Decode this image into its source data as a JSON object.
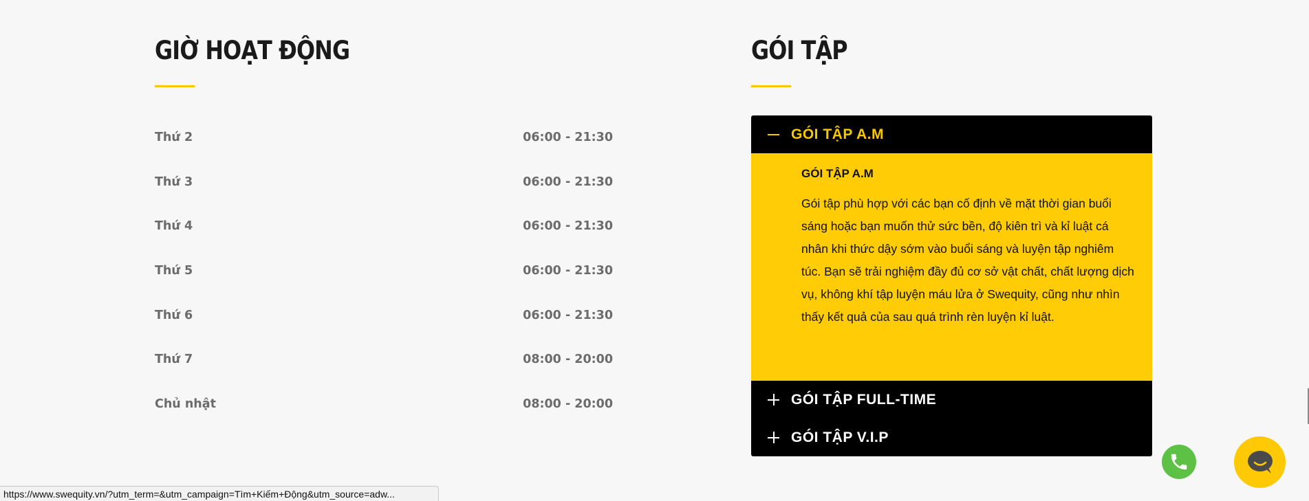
{
  "hours": {
    "title": "GIỜ HOẠT ĐỘNG",
    "rows": [
      {
        "day": "Thứ 2",
        "time": "06:00 - 21:30"
      },
      {
        "day": "Thứ 3",
        "time": "06:00 - 21:30"
      },
      {
        "day": "Thứ 4",
        "time": "06:00 - 21:30"
      },
      {
        "day": "Thứ 5",
        "time": "06:00 - 21:30"
      },
      {
        "day": "Thứ 6",
        "time": "06:00 - 21:30"
      },
      {
        "day": "Thứ 7",
        "time": "08:00 - 20:00"
      },
      {
        "day": "Chủ nhật",
        "time": "08:00 - 20:00"
      }
    ]
  },
  "packages": {
    "title": "GÓI TẬP",
    "items": [
      {
        "label": "GÓI TẬP A.M",
        "expanded": true,
        "panel_title": "GÓI TẬP A.M",
        "panel_text": "Gói tập phù hợp với các bạn cố định về mặt thời gian buổi sáng hoặc bạn muốn thử sức bền, độ kiên trì và kỉ luật cá nhân khi thức dậy sớm vào buổi sáng và luyện tập nghiêm túc. Bạn sẽ trải nghiệm đầy đủ cơ sở vật chất, chất lượng dịch vụ, không khí tập luyện máu lửa ở Swequity, cũng như nhìn thấy kết quả của sau quá trình rèn luyện kỉ luật."
      },
      {
        "label": "GÓI TẬP FULL-TIME",
        "expanded": false
      },
      {
        "label": "GÓI TẬP V.I.P",
        "expanded": false
      }
    ]
  },
  "floating": {
    "phone_icon": "phone-icon",
    "chat_icon": "chat-bubble-icon"
  },
  "status_bar": {
    "url": "https://www.swequity.vn/?utm_term=&utm_campaign=Tìm+Kiếm+Động&utm_source=adw..."
  },
  "colors": {
    "accent": "#ffcc06",
    "accordion_bg": "#000000",
    "phone_green": "#5cc145"
  }
}
